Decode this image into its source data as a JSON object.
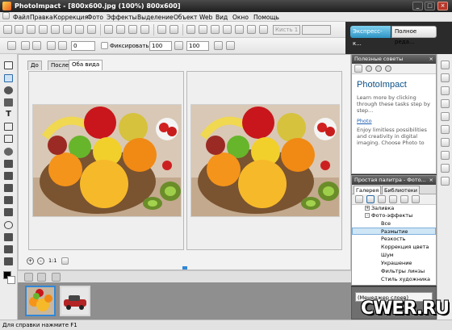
{
  "window": {
    "title": "PhotoImpact - [800x600.jpg (100%) 800x600]"
  },
  "menu": [
    "Файл",
    "Правка",
    "Коррекция",
    "Фото",
    "Эффекты",
    "Выделение",
    "Объект",
    "Web",
    "Вид",
    "Окно",
    "Помощь"
  ],
  "toolbar": {
    "preset_field": "Кисть 1",
    "express_label": "Экспресс-к...",
    "full_edit_label": "Полное реда..."
  },
  "attr_toolbar": {
    "size_value": "0",
    "fix_label": "Фиксировать",
    "width_value": "100",
    "height_value": "100"
  },
  "document": {
    "tabs": [
      "До",
      "После",
      "Оба вида"
    ],
    "active_tab": "Оба вида"
  },
  "tips_panel": {
    "header": "Полезные советы",
    "title": "PhotoImpact",
    "text": "Learn more by clicking through these tasks step by step...",
    "link": "Photo",
    "desc": "Enjoy limitless possibilities and creativity in digital imaging. Choose Photo to"
  },
  "palette_panel": {
    "header": "Простая палитра - Фото...",
    "tabs": [
      "Галерея",
      "Библиотеки"
    ],
    "tree": [
      {
        "label": "Заливка",
        "indent": 1,
        "expander": "+"
      },
      {
        "label": "Фото-эффекты",
        "indent": 1,
        "expander": "-"
      },
      {
        "label": "Все",
        "indent": 2
      },
      {
        "label": "Размытие",
        "indent": 2,
        "selected": true
      },
      {
        "label": "Резкость",
        "indent": 2
      },
      {
        "label": "Коррекция цвета",
        "indent": 2
      },
      {
        "label": "Шум",
        "indent": 2
      },
      {
        "label": "Украшение",
        "indent": 2
      },
      {
        "label": "Фильтры линзы",
        "indent": 2
      },
      {
        "label": "Стиль художника",
        "indent": 2
      }
    ]
  },
  "layer_manager": {
    "label": "(Менеджер слоев)"
  },
  "status": {
    "text": "Для справки нажмите F1"
  },
  "watermark": "CWER.RU"
}
